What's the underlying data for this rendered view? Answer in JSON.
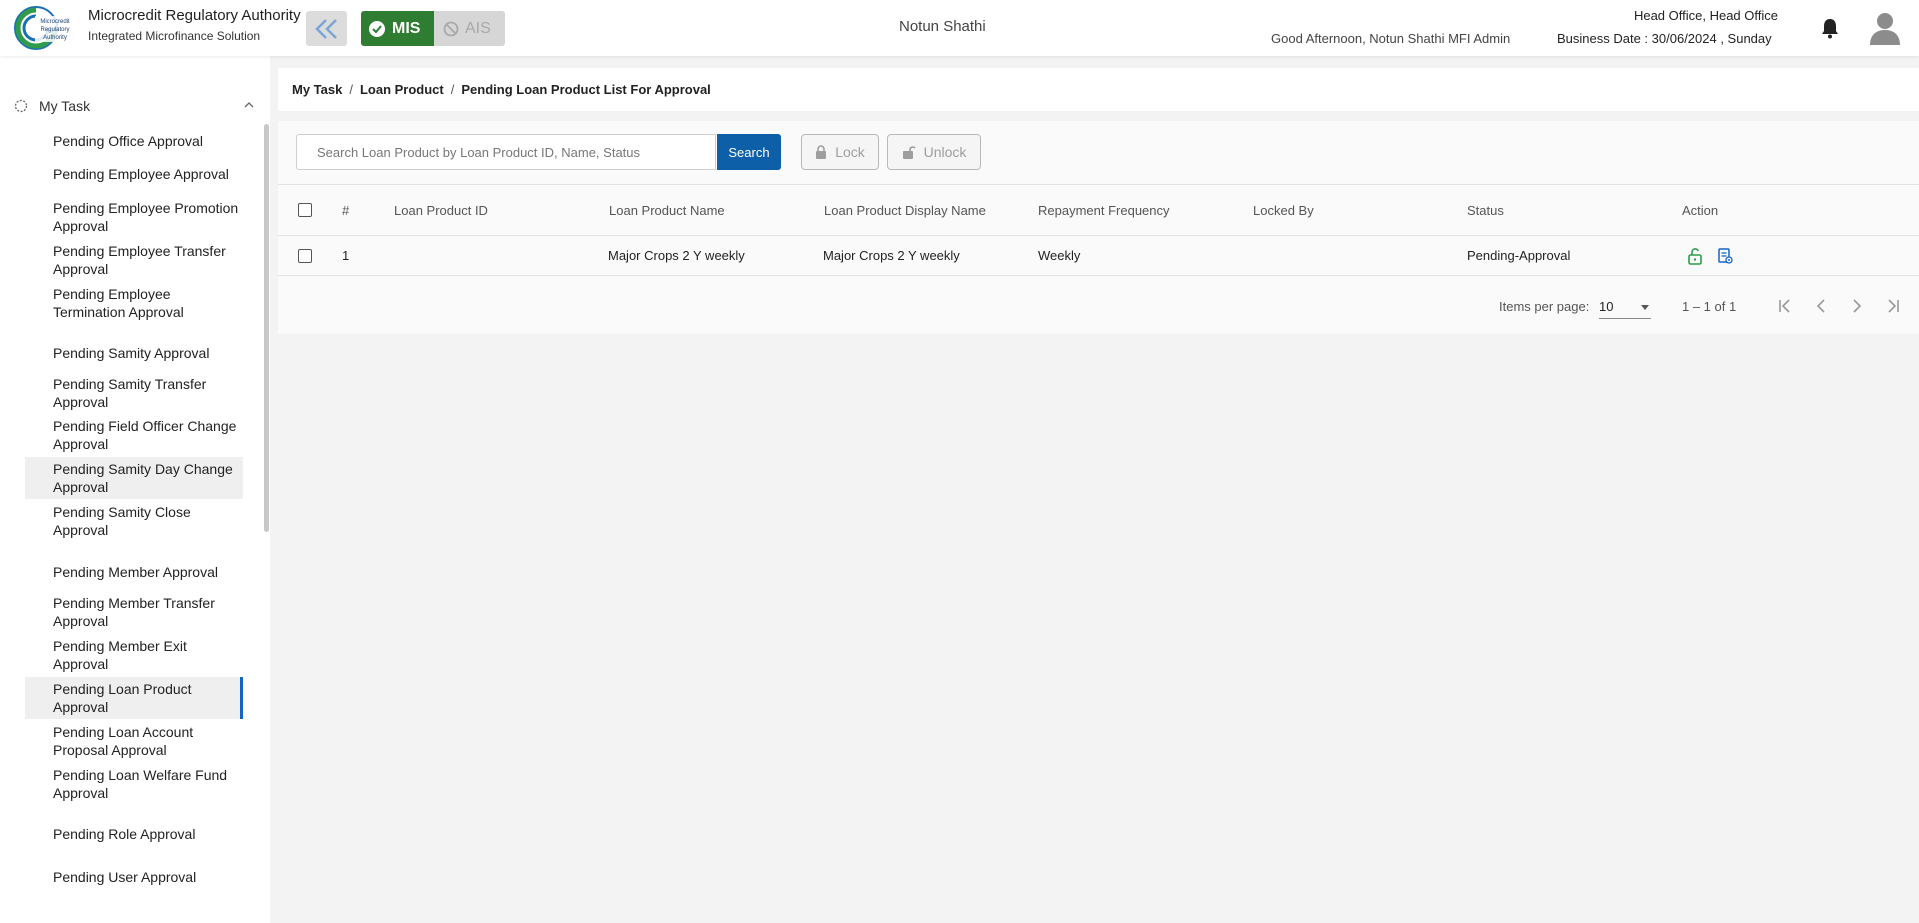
{
  "header": {
    "brand_title": "Microcredit Regulatory Authority",
    "brand_subtitle": "Integrated Microfinance Solution",
    "logo_text": "Microcredit Regulatory Authority",
    "mis_label": "MIS",
    "ais_label": "AIS",
    "org_name": "Notun Shathi",
    "greeting": "Good Afternoon, Notun Shathi MFI Admin",
    "office": "Head Office, Head Office",
    "business_date": "Business Date : 30/06/2024 , Sunday",
    "accent_color": "#2e7d32"
  },
  "sidebar": {
    "section_label": "My Task",
    "items": [
      {
        "label": "Pending Office Approval",
        "state": "normal"
      },
      {
        "label": "Pending Employee Approval",
        "state": "normal"
      },
      {
        "label": "Pending Employee Promotion Approval",
        "state": "normal"
      },
      {
        "label": "Pending Employee Transfer Approval",
        "state": "normal"
      },
      {
        "label": "Pending Employee Termination Approval",
        "state": "normal"
      },
      {
        "label": "Pending Samity Approval",
        "state": "normal"
      },
      {
        "label": "Pending Samity Transfer Approval",
        "state": "normal"
      },
      {
        "label": "Pending Field Officer Change Approval",
        "state": "normal"
      },
      {
        "label": "Pending Samity Day Change Approval",
        "state": "hover"
      },
      {
        "label": "Pending Samity Close Approval",
        "state": "normal"
      },
      {
        "label": "Pending Member Approval",
        "state": "normal"
      },
      {
        "label": "Pending Member Transfer Approval",
        "state": "normal"
      },
      {
        "label": "Pending Member Exit Approval",
        "state": "normal"
      },
      {
        "label": "Pending Loan Product Approval",
        "state": "active"
      },
      {
        "label": "Pending Loan Account Proposal Approval",
        "state": "normal"
      },
      {
        "label": "Pending Loan Welfare Fund Approval",
        "state": "normal"
      },
      {
        "label": "Pending Role Approval",
        "state": "normal"
      },
      {
        "label": "Pending User Approval",
        "state": "normal"
      }
    ]
  },
  "breadcrumb": [
    "My Task",
    "Loan Product",
    "Pending Loan Product List For Approval"
  ],
  "toolbar": {
    "search_placeholder": "Search Loan Product by Loan Product ID, Name, Status",
    "search_label": "Search",
    "lock_label": "Lock",
    "unlock_label": "Unlock"
  },
  "table": {
    "columns": [
      "#",
      "Loan Product ID",
      "Loan Product Name",
      "Loan Product Display Name",
      "Repayment Frequency",
      "Locked By",
      "Status",
      "Action"
    ],
    "rows": [
      {
        "index": "1",
        "product_id": "",
        "name": "Major Crops 2 Y weekly",
        "display_name": "Major Crops 2 Y weekly",
        "frequency": "Weekly",
        "locked_by": "",
        "status": "Pending-Approval"
      }
    ]
  },
  "paginator": {
    "items_per_page_label": "Items per page:",
    "page_size": "10",
    "range": "1 – 1 of 1"
  }
}
